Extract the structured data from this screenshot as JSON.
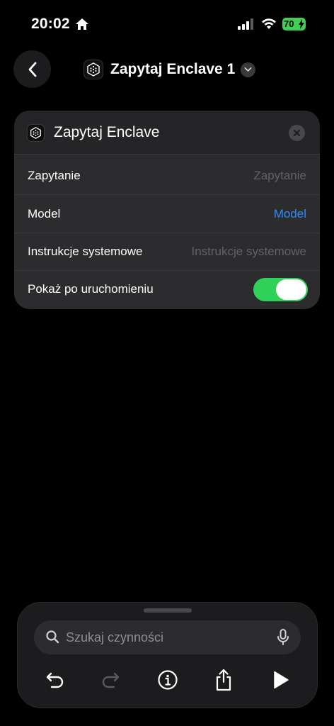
{
  "status_bar": {
    "time": "20:02",
    "battery": "70"
  },
  "nav": {
    "title": "Zapytaj Enclave 1"
  },
  "card": {
    "title": "Zapytaj Enclave",
    "rows": [
      {
        "label": "Zapytanie",
        "value": "Zapytanie"
      },
      {
        "label": "Model",
        "value": "Model"
      },
      {
        "label": "Instrukcje systemowe",
        "value": "Instrukcje systemowe"
      },
      {
        "label": "Pokaż po uruchomieniu",
        "toggle_on": true
      }
    ]
  },
  "bottom": {
    "search_placeholder": "Szukaj czynności",
    "icons": [
      "undo-icon",
      "redo-icon",
      "info-icon",
      "share-icon",
      "play-icon"
    ]
  },
  "colors": {
    "accent": "#2d8cff",
    "toggle_on": "#30d158",
    "battery": "#3fd055"
  }
}
